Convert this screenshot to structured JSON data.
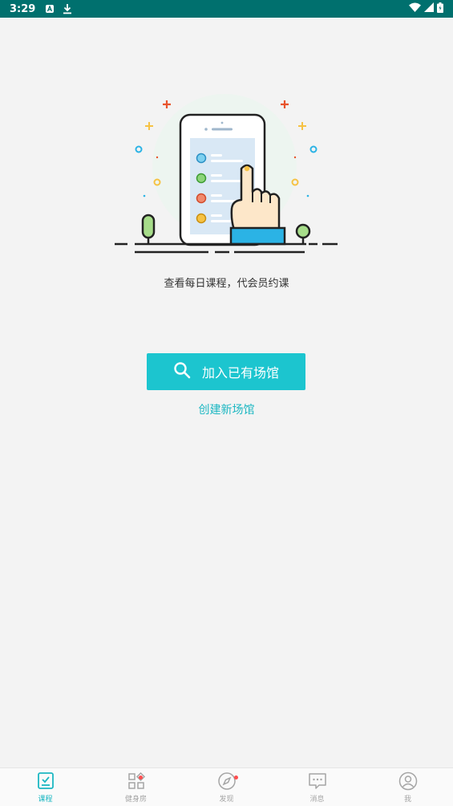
{
  "status_bar": {
    "time": "3:29"
  },
  "main": {
    "description": "查看每日课程，代会员约课",
    "join_button_label": "加入已有场馆",
    "create_link_label": "创建新场馆"
  },
  "tabs": [
    {
      "label": "课程",
      "icon": "course-icon",
      "active": true
    },
    {
      "label": "健身房",
      "icon": "gym-icon",
      "badge": true
    },
    {
      "label": "发现",
      "icon": "discover-icon",
      "badge": true
    },
    {
      "label": "消息",
      "icon": "message-icon"
    },
    {
      "label": "我",
      "icon": "profile-icon"
    }
  ],
  "colors": {
    "status_bar": "#00706e",
    "accent": "#1cc5cf",
    "link": "#1cb7c2"
  }
}
